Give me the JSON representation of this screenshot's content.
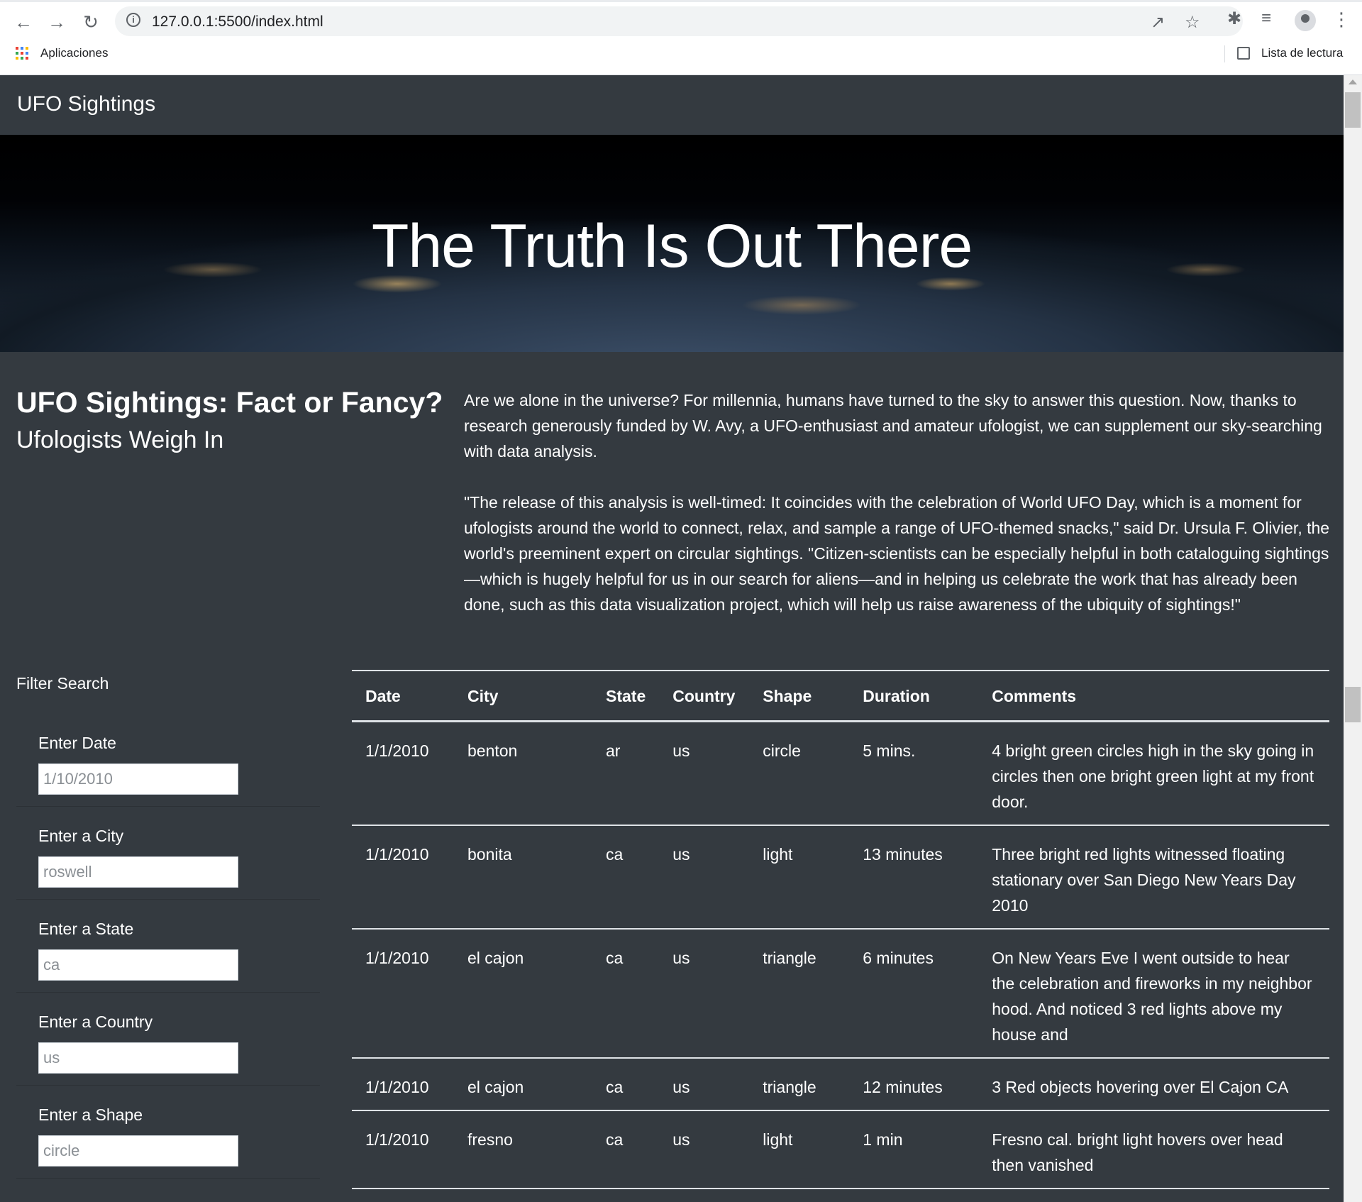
{
  "browser": {
    "url": "127.0.0.1:5500/index.html",
    "bookmarks_apps_label": "Aplicaciones",
    "reading_list_label": "Lista de lectura"
  },
  "navbar": {
    "brand": "UFO Sightings"
  },
  "hero": {
    "title": "The Truth Is Out There"
  },
  "article": {
    "title": "UFO Sightings: Fact or Fancy?",
    "subtitle": "Ufologists Weigh In",
    "paragraph1": "Are we alone in the universe? For millennia, humans have turned to the sky to answer this question. Now, thanks to research generously funded by W. Avy, a UFO-enthusiast and amateur ufologist, we can supplement our sky-searching with data analysis.",
    "paragraph2": "\"The release of this analysis is well-timed: It coincides with the celebration of World UFO Day, which is a moment for ufologists around the world to connect, relax, and sample a range of UFO-themed snacks,\" said Dr. Ursula F. Olivier, the world's preeminent expert on circular sightings. \"Citizen-scientists can be especially helpful in both cataloguing sightings—which is hugely helpful for us in our search for aliens—and in helping us celebrate the work that has already been done, such as this data visualization project, which will help us raise awareness of the ubiquity of sightings!\""
  },
  "filters": {
    "title": "Filter Search",
    "fields": [
      {
        "label": "Enter Date",
        "placeholder": "1/10/2010"
      },
      {
        "label": "Enter a City",
        "placeholder": "roswell"
      },
      {
        "label": "Enter a State",
        "placeholder": "ca"
      },
      {
        "label": "Enter a Country",
        "placeholder": "us"
      },
      {
        "label": "Enter a Shape",
        "placeholder": "circle"
      }
    ]
  },
  "table": {
    "columns": [
      "Date",
      "City",
      "State",
      "Country",
      "Shape",
      "Duration",
      "Comments"
    ],
    "rows": [
      [
        "1/1/2010",
        "benton",
        "ar",
        "us",
        "circle",
        "5 mins.",
        "4 bright green circles high in the sky going in circles then one bright green light at my front door."
      ],
      [
        "1/1/2010",
        "bonita",
        "ca",
        "us",
        "light",
        "13 minutes",
        "Three bright red lights witnessed floating stationary over San Diego New Years Day 2010"
      ],
      [
        "1/1/2010",
        "el cajon",
        "ca",
        "us",
        "triangle",
        "6 minutes",
        "On New Years Eve I went outside to hear the celebration and fireworks in my neighbor hood. And noticed 3 red lights above my house and"
      ],
      [
        "1/1/2010",
        "el cajon",
        "ca",
        "us",
        "triangle",
        "12 minutes",
        "3 Red objects hovering over El Cajon CA"
      ],
      [
        "1/1/2010",
        "fresno",
        "ca",
        "us",
        "light",
        "1 min",
        "Fresno cal. bright light hovers over head then vanished"
      ]
    ]
  },
  "colors": {
    "page_background": "#343a40",
    "text": "#ffffff",
    "table_border": "#dee2e6"
  },
  "icons": [
    "back-arrow-icon",
    "forward-arrow-icon",
    "reload-icon",
    "site-info-icon",
    "share-icon",
    "bookmark-star-icon",
    "extensions-puzzle-icon",
    "media-queue-icon",
    "profile-avatar-icon",
    "menu-kebab-icon",
    "apps-grid-icon",
    "reading-list-icon"
  ]
}
